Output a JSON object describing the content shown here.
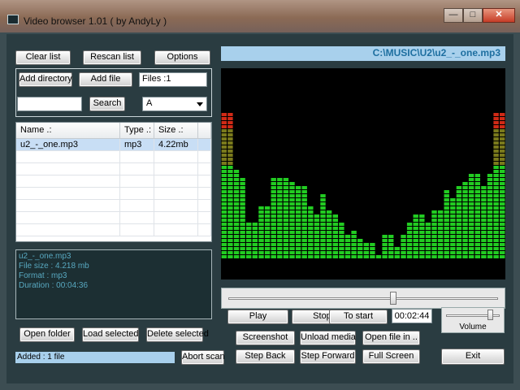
{
  "window": {
    "title": "Video browser 1.01 ( by AndyLy )",
    "min": "—",
    "max": "□",
    "close": "✕"
  },
  "top_buttons": {
    "clear_list": "Clear list",
    "rescan_list": "Rescan list",
    "options": "Options"
  },
  "group": {
    "add_directory": "Add directory",
    "add_file": "Add file",
    "files_count": "Files :1",
    "search_value": "",
    "search_button": "Search",
    "filter_value": "A"
  },
  "file_list": {
    "columns": [
      "Name .:",
      "Type .:",
      "Size .:"
    ],
    "rows": [
      [
        "u2_-_one.mp3",
        "mp3",
        "4.22mb"
      ]
    ]
  },
  "info_panel": {
    "lines": [
      "u2_-_one.mp3",
      "File size : 4.218 mb",
      "Format : mp3",
      "Duration : 00:04:36"
    ]
  },
  "bottom_left": {
    "open_folder": "Open folder",
    "load_selected": "Load selected",
    "delete_selected": "Delete selected",
    "status": "Added : 1 file",
    "abort_scan": "Abort scan"
  },
  "player": {
    "path": "C:\\MUSIC\\U2\\u2_-_one.mp3",
    "position_fraction": 0.61,
    "play": "Play",
    "stop": "Stop",
    "to_start": "To start",
    "time": "00:02:44",
    "volume_label": "Volume",
    "volume_fraction": 0.85,
    "screenshot": "Screenshot",
    "unload_media": "Unload media",
    "open_file_in": "Open file in ..",
    "step_back": "Step Back",
    "step_forward": "Step Forward",
    "full_screen": "Full Screen",
    "exit": "Exit"
  },
  "visualizer": {
    "levels": [
      0.78,
      0.78,
      0.47,
      0.44,
      0.19,
      0.19,
      0.29,
      0.29,
      0.44,
      0.44,
      0.44,
      0.42,
      0.39,
      0.39,
      0.28,
      0.23,
      0.34,
      0.25,
      0.23,
      0.2,
      0.14,
      0.16,
      0.11,
      0.08,
      0.09,
      0.03,
      0.14,
      0.13,
      0.07,
      0.14,
      0.19,
      0.24,
      0.24,
      0.19,
      0.25,
      0.27,
      0.36,
      0.33,
      0.39,
      0.41,
      0.46,
      0.46,
      0.4,
      0.45,
      0.78,
      0.78
    ],
    "colors": {
      "low": "#22cc22",
      "mid": "#7a7a1c",
      "high": "#d02a16"
    }
  }
}
